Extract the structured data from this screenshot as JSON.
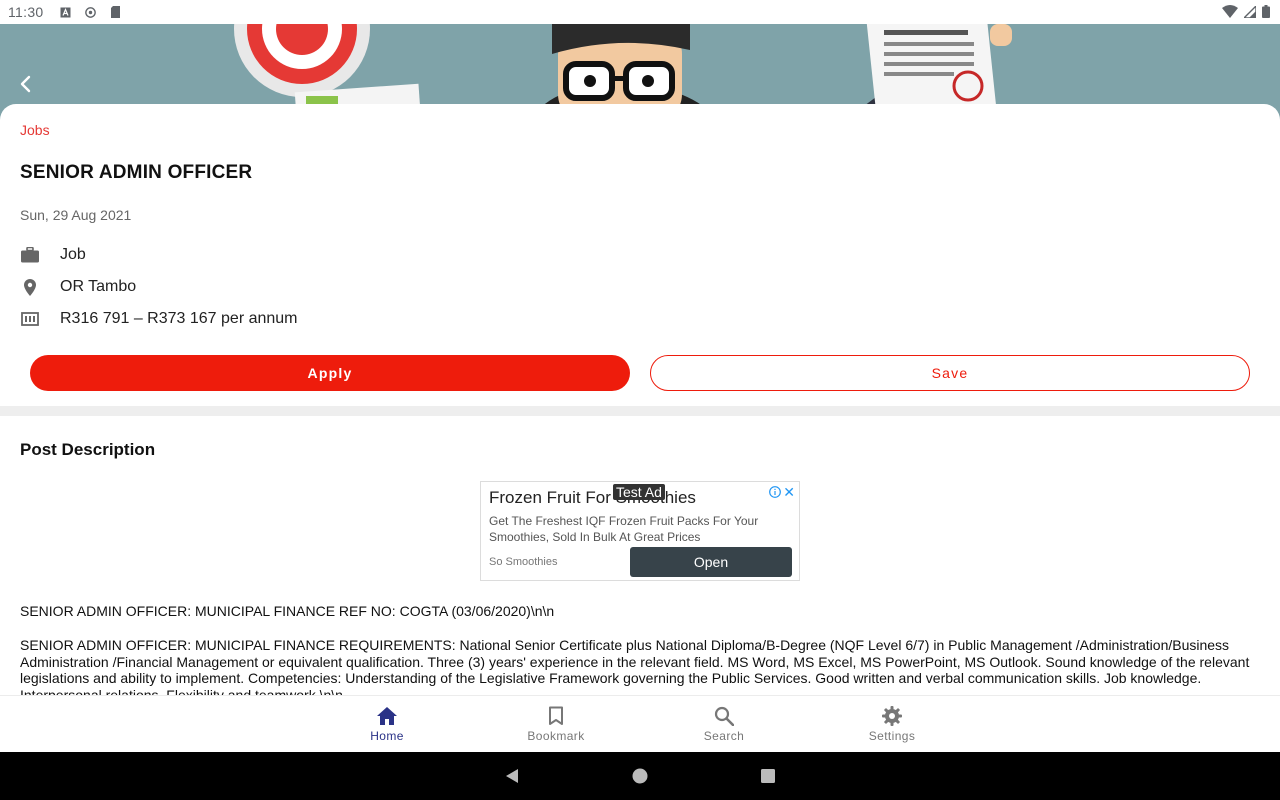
{
  "status_bar": {
    "time": "11:30"
  },
  "header": {
    "back_icon": "arrow-back-icon"
  },
  "job": {
    "category": "Jobs",
    "title": "SENIOR ADMIN OFFICER",
    "date": "Sun, 29 Aug 2021",
    "type": "Job",
    "location": "OR Tambo",
    "salary": "R316 791 – R373 167 per annum",
    "apply_label": "Apply",
    "save_label": "Save"
  },
  "description": {
    "section_title": "Post Description",
    "paragraph_1": "SENIOR ADMIN OFFICER: MUNICIPAL FINANCE REF NO: COGTA (03/06/2020)\\n\\n",
    "paragraph_2": "SENIOR ADMIN OFFICER: MUNICIPAL FINANCE REQUIREMENTS: National Senior Certificate plus National Diploma/B-Degree (NQF Level 6/7) in Public Management /Administration/Business Administration /Financial Management or equivalent qualification. Three (3) years' experience in the relevant field. MS Word, MS Excel, MS PowerPoint, MS Outlook. Sound knowledge of the relevant legislations and ability to implement. Competencies: Understanding of the Legislative Framework governing the Public Services. Good written and verbal communication skills. Job knowledge. Interpersonal relations. Flexibility and teamwork.\\n\\n"
  },
  "ad": {
    "label": "Test Ad",
    "headline": "Frozen Fruit For Smoothies",
    "body": "Get The Freshest IQF Frozen Fruit Packs For Your Smoothies, Sold In Bulk At Great Prices",
    "advertiser": "So Smoothies",
    "cta": "Open",
    "close": "✕"
  },
  "bottom_nav": {
    "items": [
      {
        "label": "Home",
        "icon": "home-icon",
        "active": true
      },
      {
        "label": "Bookmark",
        "icon": "bookmark-icon",
        "active": false
      },
      {
        "label": "Search",
        "icon": "search-icon",
        "active": false
      },
      {
        "label": "Settings",
        "icon": "gear-icon",
        "active": false
      }
    ]
  },
  "colors": {
    "accent": "#ee1c0c",
    "nav_active": "#2a3287",
    "hero_bg": "#7fa3a9"
  }
}
